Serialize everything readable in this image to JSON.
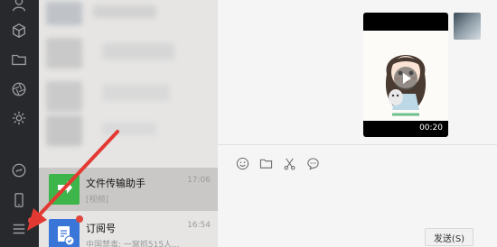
{
  "sidebar": {
    "icons": [
      "contacts-icon",
      "favorites-icon",
      "folder-icon",
      "moments-icon",
      "settings-gear-icon",
      "mini-program-icon",
      "phone-icon",
      "menu-icon"
    ]
  },
  "conversations": [
    {
      "name": "文件传输助手",
      "time": "17:06",
      "preview": "[视频]",
      "selected": true
    },
    {
      "name": "订阅号",
      "time": "16:54",
      "preview": "中国禁毒: 一窝抓515人..."
    }
  ],
  "chat": {
    "video_duration": "00:20",
    "send_label": "发送(S)",
    "toolbar_icons": [
      "emoji-icon",
      "file-icon",
      "screenshot-icon",
      "chat-history-icon"
    ]
  },
  "colors": {
    "sidebar_bg": "#27292d",
    "list_bg": "#e6e5e4",
    "file_transfer_green": "#3eb54a",
    "subscription_blue": "#3a76d8",
    "annotation_red": "#e23a32"
  }
}
